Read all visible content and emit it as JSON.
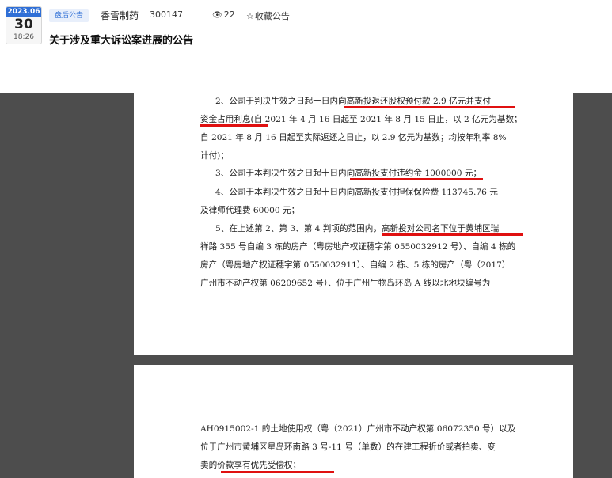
{
  "header": {
    "date_badge": {
      "year_month": "2023.06",
      "day": "30",
      "time": "18:26"
    },
    "tag": "盘后公告",
    "company": "香雪制药",
    "code": "300147",
    "views": {
      "icon": "eye-icon",
      "count": "22"
    },
    "favorite": {
      "icon": "star-icon",
      "label": "收藏公告"
    },
    "title": "关于涉及重大诉讼案进展的公告"
  },
  "document": {
    "page1_lines": [
      "2、公司于判决生效之日起十日内向高新投返还股权预付款 2.9 亿元并支付",
      "资金占用利息(自 2021 年 4 月 16 日起至 2021 年 8 月 15 日止，以 2 亿元为基数；",
      "自 2021 年 8 月 16 日起至实际返还之日止，以 2.9 亿元为基数；均按年利率 8%",
      "计付)；",
      "3、公司于本判决生效之日起十日内向高新投支付违约金 1000000 元；",
      "4、公司于本判决生效之日起十日内向高新投支付担保保险费 113745.76 元",
      "及律师代理费 60000 元；",
      "5、在上述第 2、第 3、第 4 判项的范围内，高新投对公司名下位于黄埔区瑞",
      "祥路 355 号自编 3 栋的房产（粤房地产权证穗字第 0550032912 号）、自编 4 栋的",
      "房产（粤房地产权证穗字第 0550032911）、自编 2 栋、5 栋的房产（粤（2017）",
      "广州市不动产权第 06209652 号）、位于广州生物岛环岛 A 线以北地块编号为"
    ],
    "page2_lines": [
      "AH0915002-1 的土地使用权（粤（2021）广州市不动产权第 06072350 号）以及",
      "位于广州市黄埔区星岛环南路 3 号-11 号（单数）的在建工程折价或者拍卖、变",
      "卖的价款享有优先受偿权；"
    ],
    "highlight_color": "#e01010"
  }
}
